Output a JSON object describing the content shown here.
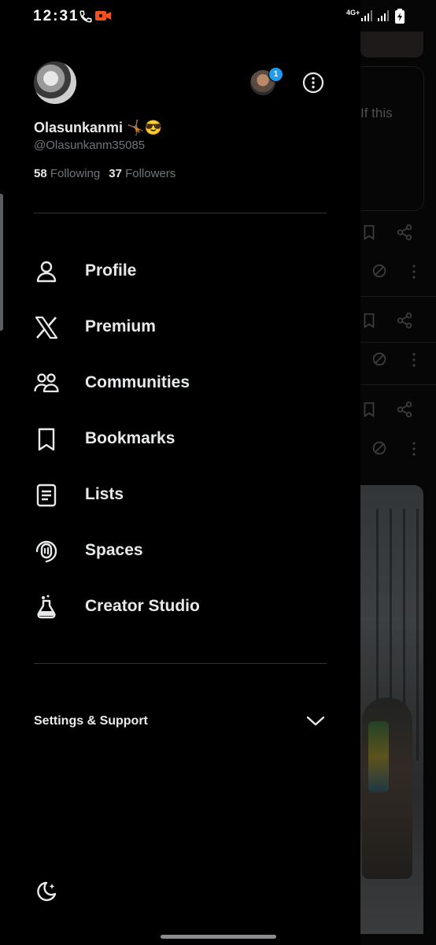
{
  "status_bar": {
    "time": "12:31",
    "network": "4G+",
    "icons": [
      "phone-call-icon",
      "screen-record-icon",
      "signal-icon",
      "signal-icon",
      "battery-charging-icon"
    ],
    "record_color": "#f4511e"
  },
  "profile": {
    "display_name": "Olasunkanmi 🤸🏾😎",
    "handle": "@Olasunkanm35085",
    "following_count": "58",
    "following_label": "Following",
    "followers_count": "37",
    "followers_label": "Followers",
    "notification_badge": "1"
  },
  "menu": [
    {
      "label": "Profile",
      "icon": "person-icon"
    },
    {
      "label": "Premium",
      "icon": "x-logo-icon"
    },
    {
      "label": "Communities",
      "icon": "communities-icon"
    },
    {
      "label": "Bookmarks",
      "icon": "bookmark-icon"
    },
    {
      "label": "Lists",
      "icon": "list-icon"
    },
    {
      "label": "Spaces",
      "icon": "spaces-icon"
    },
    {
      "label": "Creator Studio",
      "icon": "flask-icon"
    }
  ],
  "settings": {
    "label": "Settings & Support",
    "expanded": false
  },
  "background_feed": {
    "snippet": "If this"
  },
  "colors": {
    "background": "#000000",
    "text": "#e7e9ea",
    "muted": "#71767b",
    "divider": "#2f3336",
    "accent": "#1d9bf0"
  }
}
